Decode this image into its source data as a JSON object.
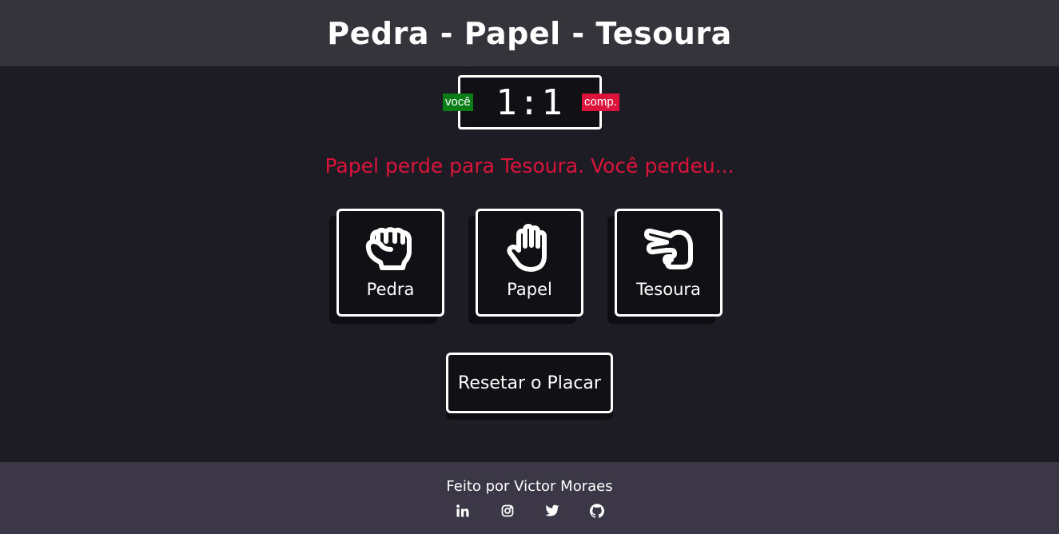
{
  "header": {
    "title": "Pedra - Papel - Tesoura"
  },
  "scoreboard": {
    "user_label": "você",
    "computer_label": "comp.",
    "user_score": "1",
    "separator": ":",
    "computer_score": "1"
  },
  "result": {
    "message": "Papel perde para Tesoura. Você perdeu..."
  },
  "choices": [
    {
      "label": "Pedra",
      "icon": "fist-icon"
    },
    {
      "label": "Papel",
      "icon": "open-hand-icon"
    },
    {
      "label": "Tesoura",
      "icon": "scissors-hand-icon"
    }
  ],
  "reset": {
    "label": "Resetar o Placar"
  },
  "footer": {
    "credit": "Feito por Victor Moraes",
    "socials": [
      "linkedin-icon",
      "instagram-icon",
      "twitter-icon",
      "github-icon"
    ]
  },
  "colors": {
    "header_bg": "#36343b",
    "page_bg": "#1d1b24",
    "footer_bg": "#3b3746",
    "user_badge": "#0a7d16",
    "comp_badge": "#dc143c",
    "result_text": "#dc143c"
  }
}
